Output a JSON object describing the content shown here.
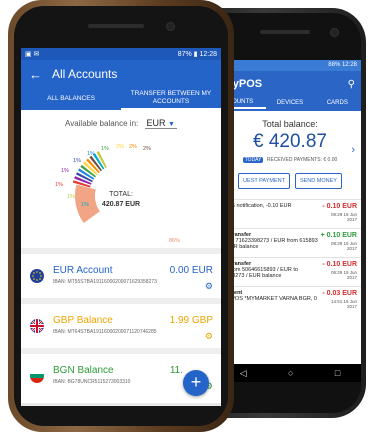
{
  "back_screen": {
    "status": "88% 12:28",
    "app_title": "myPOS",
    "tabs": [
      "OUNTS",
      "DEVICES",
      "CARDS"
    ],
    "total_label": "Total balance:",
    "total_amount": "€ 420.87",
    "today_badge": "TODAY",
    "received_text": "RECEIVED PAYMENTS: € 0.00",
    "buttons": {
      "request": "UEST PAYMENT",
      "send": "SEND MONEY"
    },
    "transactions": [
      {
        "title": "",
        "desc": "SMS notification, -0.10 EUR",
        "amount": "- 0.10 EUR",
        "date": "08:29 19 Jun 2017",
        "type": "debit"
      },
      {
        "title": "ce transfer",
        "desc": "er to 71623398273 / EUR from 615893 / EUR balance",
        "amount": "+ 0.10 EUR",
        "date": "08:29 19 Jun 2017",
        "type": "credit"
      },
      {
        "title": "ce transfer",
        "desc": "er from 50646615893 / EUR to 3398273 / EUR balance",
        "amount": "- 0.10 EUR",
        "date": "08:29 19 Jun 2017",
        "type": "debit"
      },
      {
        "title": "ayment",
        "desc": "MYPOS *MYMARKET VARNA BGR, 0",
        "amount": "- 0.03 EUR",
        "date": "14:51 16 Jun 2017",
        "type": "debit"
      }
    ]
  },
  "front_screen": {
    "status_time": "12:28",
    "status_battery": "87%",
    "app_title": "All Accounts",
    "tabs": [
      "ALL BALANCES",
      "TRANSFER BETWEEN MY ACCOUNTS"
    ],
    "available_label": "Available balance in:",
    "currency": "EUR",
    "donut_center_label": "TOTAL:",
    "donut_center_value": "420.87 EUR",
    "donut_labels": [
      "1%",
      "1%",
      "1%",
      "1%",
      "1%",
      "2%",
      "2%",
      "2%",
      "1%",
      "1%",
      "86%"
    ],
    "accounts": [
      {
        "name": "EUR Account",
        "balance": "0.00 EUR",
        "iban": "IBAN: MT55STBA19116000200071629358273",
        "color": "#2463c8"
      },
      {
        "name": "GBP Balance",
        "balance": "1.99 GBP",
        "iban": "IBAN: MT64STBA19116000200071120746285",
        "color": "#f0a500"
      },
      {
        "name": "BGN Balance",
        "balance": "11.",
        "iban": "IBAN: BG78UNCR5115273003310",
        "color": "#2e9b3a"
      }
    ],
    "colors": {
      "primary": "#2463c8",
      "donut_main": "#f2a585"
    }
  }
}
